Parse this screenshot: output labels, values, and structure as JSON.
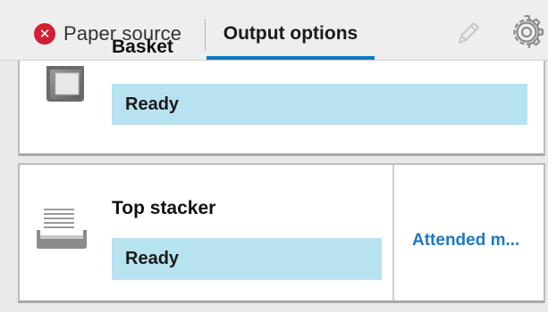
{
  "tabs": {
    "paper_source": {
      "label": "Paper source",
      "status": "error"
    },
    "output_options": {
      "label": "Output options",
      "selected": true
    }
  },
  "toolbar": {
    "edit_icon": "pencil-icon",
    "settings_icon": "gear-icon"
  },
  "outputs": [
    {
      "name": "Basket",
      "status": "Ready",
      "icon": "basket-tray-icon"
    },
    {
      "name": "Top stacker",
      "status": "Ready",
      "icon": "stacker-tray-icon",
      "mode": "Attended m..."
    }
  ],
  "colors": {
    "accent": "#0a7ac2",
    "error": "#d11f33",
    "status_bar": "#b7e2ef",
    "link": "#1f78c1"
  }
}
